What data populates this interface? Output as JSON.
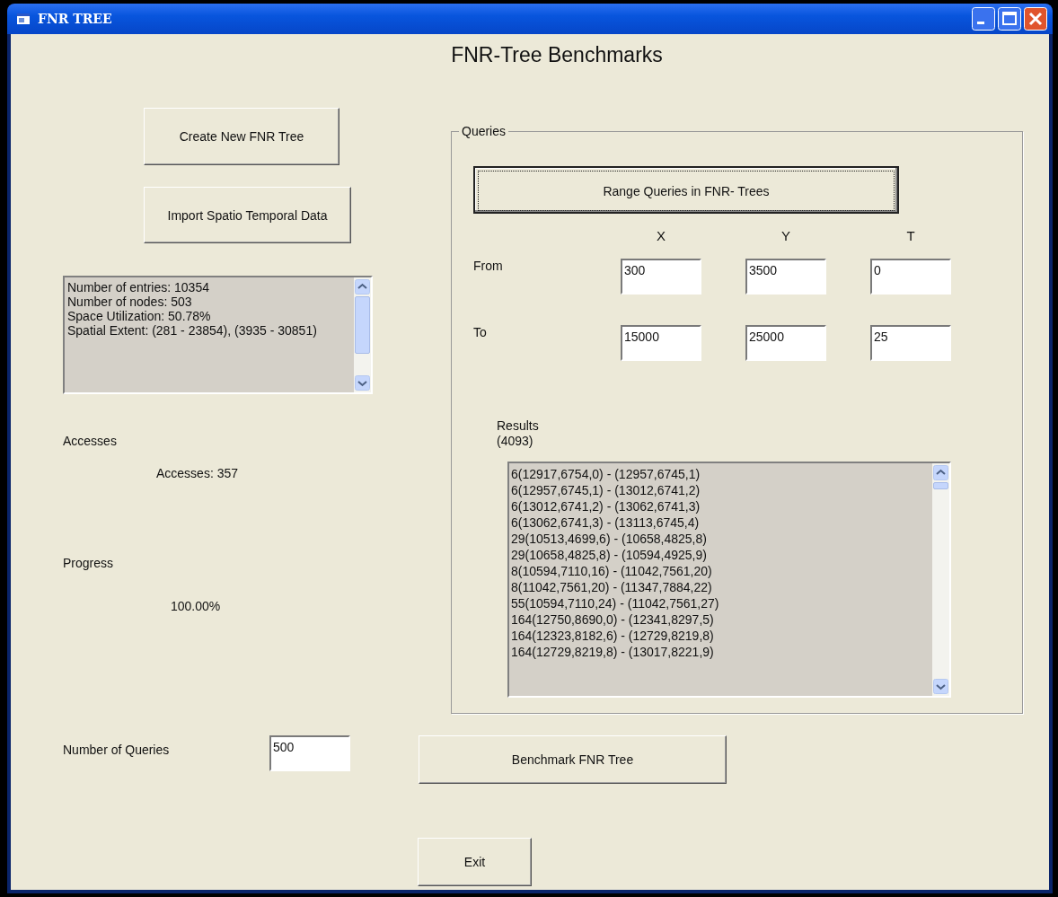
{
  "window": {
    "title": "FNR TREE"
  },
  "heading": "FNR-Tree Benchmarks",
  "left": {
    "buttons": [
      {
        "label": "Create New FNR Tree",
        "focused": false
      },
      {
        "label": "Import Spatio Temporal Data",
        "focused": false
      }
    ],
    "info_lines": [
      "Number of entries: 10354",
      "Number of nodes: 503",
      "Space Utilization: 50.78%",
      "Spatial Extent: (281 - 23854), (3935 - 30851)"
    ],
    "accesses_label": "Accesses",
    "accesses_value": "Accesses: 357",
    "progress_label": "Progress",
    "progress_value": "100.00%"
  },
  "queries": {
    "title": "Queries",
    "button": {
      "label": "Range Queries in FNR- Trees",
      "focused": true
    },
    "columns": [
      "X",
      "Y",
      "T"
    ],
    "rows": [
      {
        "label": "From",
        "values": [
          "300",
          "3500",
          "0"
        ]
      },
      {
        "label": "To",
        "values": [
          "15000",
          "25000",
          "25"
        ]
      }
    ],
    "results_label": "Results",
    "results_count": "(4093)",
    "results": [
      "6(12917,6754,0) - (12957,6745,1)",
      "6(12957,6745,1) - (13012,6741,2)",
      "6(13012,6741,2) - (13062,6741,3)",
      "6(13062,6741,3) - (13113,6745,4)",
      "29(10513,4699,6) - (10658,4825,8)",
      "29(10658,4825,8) - (10594,4925,9)",
      "8(10594,7110,16) - (11042,7561,20)",
      "8(11042,7561,20) - (11347,7884,22)",
      "55(10594,7110,24) - (11042,7561,27)",
      "164(12750,8690,0) - (12341,8297,5)",
      "164(12323,8182,6) - (12729,8219,8)",
      "164(12729,8219,8) - (13017,8221,9)"
    ]
  },
  "number_of_queries": {
    "label": "Number of Queries",
    "value": "500"
  },
  "benchmark_button": {
    "label": "Benchmark FNR Tree",
    "focused": false
  },
  "exit_button": {
    "label": "Exit",
    "focused": false
  }
}
